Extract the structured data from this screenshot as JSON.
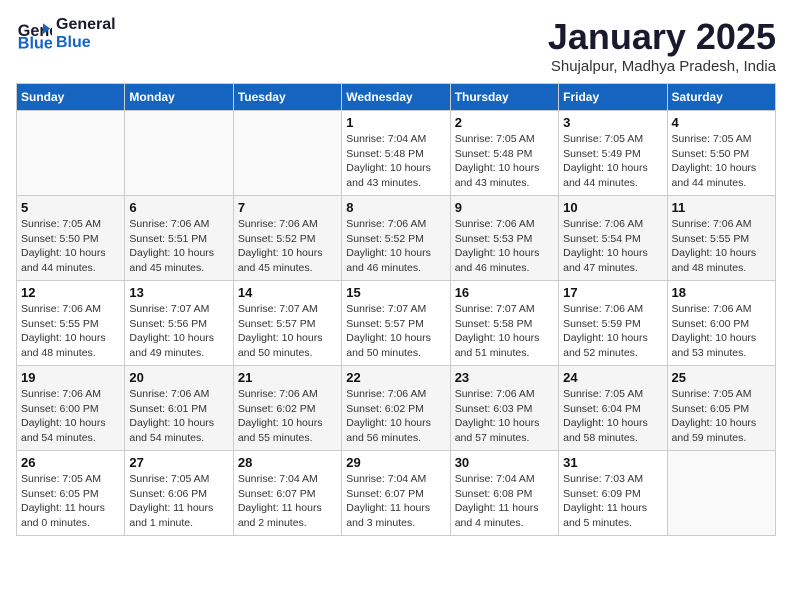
{
  "logo": {
    "line1": "General",
    "line2": "Blue"
  },
  "title": "January 2025",
  "subtitle": "Shujalpur, Madhya Pradesh, India",
  "weekdays": [
    "Sunday",
    "Monday",
    "Tuesday",
    "Wednesday",
    "Thursday",
    "Friday",
    "Saturday"
  ],
  "weeks": [
    [
      {
        "day": "",
        "info": ""
      },
      {
        "day": "",
        "info": ""
      },
      {
        "day": "",
        "info": ""
      },
      {
        "day": "1",
        "info": "Sunrise: 7:04 AM\nSunset: 5:48 PM\nDaylight: 10 hours\nand 43 minutes."
      },
      {
        "day": "2",
        "info": "Sunrise: 7:05 AM\nSunset: 5:48 PM\nDaylight: 10 hours\nand 43 minutes."
      },
      {
        "day": "3",
        "info": "Sunrise: 7:05 AM\nSunset: 5:49 PM\nDaylight: 10 hours\nand 44 minutes."
      },
      {
        "day": "4",
        "info": "Sunrise: 7:05 AM\nSunset: 5:50 PM\nDaylight: 10 hours\nand 44 minutes."
      }
    ],
    [
      {
        "day": "5",
        "info": "Sunrise: 7:05 AM\nSunset: 5:50 PM\nDaylight: 10 hours\nand 44 minutes."
      },
      {
        "day": "6",
        "info": "Sunrise: 7:06 AM\nSunset: 5:51 PM\nDaylight: 10 hours\nand 45 minutes."
      },
      {
        "day": "7",
        "info": "Sunrise: 7:06 AM\nSunset: 5:52 PM\nDaylight: 10 hours\nand 45 minutes."
      },
      {
        "day": "8",
        "info": "Sunrise: 7:06 AM\nSunset: 5:52 PM\nDaylight: 10 hours\nand 46 minutes."
      },
      {
        "day": "9",
        "info": "Sunrise: 7:06 AM\nSunset: 5:53 PM\nDaylight: 10 hours\nand 46 minutes."
      },
      {
        "day": "10",
        "info": "Sunrise: 7:06 AM\nSunset: 5:54 PM\nDaylight: 10 hours\nand 47 minutes."
      },
      {
        "day": "11",
        "info": "Sunrise: 7:06 AM\nSunset: 5:55 PM\nDaylight: 10 hours\nand 48 minutes."
      }
    ],
    [
      {
        "day": "12",
        "info": "Sunrise: 7:06 AM\nSunset: 5:55 PM\nDaylight: 10 hours\nand 48 minutes."
      },
      {
        "day": "13",
        "info": "Sunrise: 7:07 AM\nSunset: 5:56 PM\nDaylight: 10 hours\nand 49 minutes."
      },
      {
        "day": "14",
        "info": "Sunrise: 7:07 AM\nSunset: 5:57 PM\nDaylight: 10 hours\nand 50 minutes."
      },
      {
        "day": "15",
        "info": "Sunrise: 7:07 AM\nSunset: 5:57 PM\nDaylight: 10 hours\nand 50 minutes."
      },
      {
        "day": "16",
        "info": "Sunrise: 7:07 AM\nSunset: 5:58 PM\nDaylight: 10 hours\nand 51 minutes."
      },
      {
        "day": "17",
        "info": "Sunrise: 7:06 AM\nSunset: 5:59 PM\nDaylight: 10 hours\nand 52 minutes."
      },
      {
        "day": "18",
        "info": "Sunrise: 7:06 AM\nSunset: 6:00 PM\nDaylight: 10 hours\nand 53 minutes."
      }
    ],
    [
      {
        "day": "19",
        "info": "Sunrise: 7:06 AM\nSunset: 6:00 PM\nDaylight: 10 hours\nand 54 minutes."
      },
      {
        "day": "20",
        "info": "Sunrise: 7:06 AM\nSunset: 6:01 PM\nDaylight: 10 hours\nand 54 minutes."
      },
      {
        "day": "21",
        "info": "Sunrise: 7:06 AM\nSunset: 6:02 PM\nDaylight: 10 hours\nand 55 minutes."
      },
      {
        "day": "22",
        "info": "Sunrise: 7:06 AM\nSunset: 6:02 PM\nDaylight: 10 hours\nand 56 minutes."
      },
      {
        "day": "23",
        "info": "Sunrise: 7:06 AM\nSunset: 6:03 PM\nDaylight: 10 hours\nand 57 minutes."
      },
      {
        "day": "24",
        "info": "Sunrise: 7:05 AM\nSunset: 6:04 PM\nDaylight: 10 hours\nand 58 minutes."
      },
      {
        "day": "25",
        "info": "Sunrise: 7:05 AM\nSunset: 6:05 PM\nDaylight: 10 hours\nand 59 minutes."
      }
    ],
    [
      {
        "day": "26",
        "info": "Sunrise: 7:05 AM\nSunset: 6:05 PM\nDaylight: 11 hours\nand 0 minutes."
      },
      {
        "day": "27",
        "info": "Sunrise: 7:05 AM\nSunset: 6:06 PM\nDaylight: 11 hours\nand 1 minute."
      },
      {
        "day": "28",
        "info": "Sunrise: 7:04 AM\nSunset: 6:07 PM\nDaylight: 11 hours\nand 2 minutes."
      },
      {
        "day": "29",
        "info": "Sunrise: 7:04 AM\nSunset: 6:07 PM\nDaylight: 11 hours\nand 3 minutes."
      },
      {
        "day": "30",
        "info": "Sunrise: 7:04 AM\nSunset: 6:08 PM\nDaylight: 11 hours\nand 4 minutes."
      },
      {
        "day": "31",
        "info": "Sunrise: 7:03 AM\nSunset: 6:09 PM\nDaylight: 11 hours\nand 5 minutes."
      },
      {
        "day": "",
        "info": ""
      }
    ]
  ]
}
